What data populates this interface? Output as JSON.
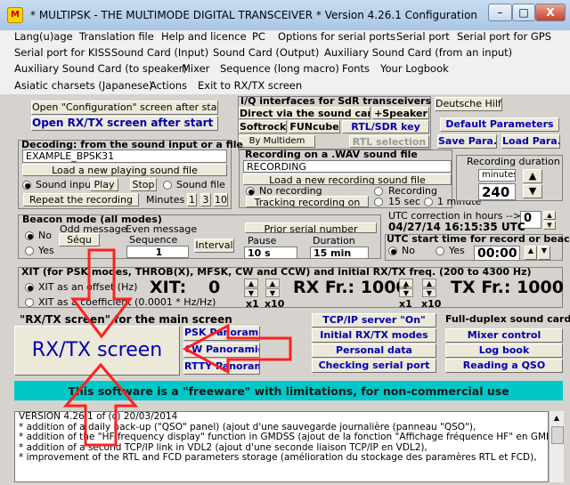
{
  "window": {
    "title": "* MULTIPSK - THE MULTIMODE DIGITAL TRANSCEIVER *   Version 4.26.1     Configuration",
    "icon": "M",
    "min": "–",
    "max": "□",
    "close": "X"
  },
  "menu": {
    "row1": [
      "Lang(u)age",
      "Translation file",
      "Help and licence",
      "PC",
      "Options for serial ports",
      "Serial port",
      "Serial port for GPS"
    ],
    "row2": [
      "Serial port for KISS",
      "Sound Card (Input)",
      "Sound Card (Output)",
      "Auxiliary Sound Card (from an input)"
    ],
    "row3": [
      "Auxiliary Sound Card (to speaker)",
      "Mixer",
      "Sequence (long macro)",
      "Fonts",
      "Your Logbook"
    ],
    "row4": [
      "Asiatic charsets (Japanese)",
      "Actions",
      "Exit to RX/TX screen"
    ]
  },
  "startup": {
    "open_config": "Open \"Configuration\" screen after start up",
    "open_rxtx": "Open RX/TX screen after start up"
  },
  "sdr": {
    "title": "I/Q interfaces for SdR transceivers",
    "direct": "Direct via the sound card",
    "speaker": "+Speaker",
    "softrock": "Softrock",
    "funcube": "FUNcube",
    "rtl_sdr": "RTL/SDR key",
    "multidem": "By Multidem",
    "rtl_sel": "RTL selection"
  },
  "right_buttons": {
    "deutsche": "Deutsche Hilfe",
    "default_params": "Default Parameters",
    "save": "Save Para.",
    "load": "Load Para."
  },
  "decoding": {
    "title": "Decoding: from the sound input or a file",
    "file": "EXAMPLE_BPSK31",
    "load_file": "Load a new playing sound file",
    "sound_input": "Sound input",
    "play": "Play",
    "stop": "Stop",
    "sound_file": "Sound file",
    "repeat": "Repeat the recording",
    "minutes": "Minutes",
    "m1": "1",
    "m3": "3",
    "m10": "10"
  },
  "recording": {
    "title": "Recording on a .WAV sound file",
    "file": "RECORDING",
    "load_file": "Load a new recording sound file",
    "no_rec": "No recording",
    "recording": "Recording",
    "tracking": "Tracking recording on",
    "sec15": "15 sec",
    "min1": "1 minute",
    "duration_label": "Recording duration",
    "minutes_label": "minutes",
    "duration_value": "240"
  },
  "beacon": {
    "title": "Beacon mode (all modes)",
    "no": "No",
    "yes": "Yes",
    "odd": "Odd message",
    "even": "Even message",
    "seq_short": "Séqu",
    "sequence": "Sequence",
    "seq_value": "1",
    "interval": "Interval",
    "prior_serial": "Prior serial number",
    "pause": "Pause",
    "pause_value": "10 s",
    "duration": "Duration",
    "duration_value": "15 min"
  },
  "utc": {
    "correction": "UTC correction in hours -->",
    "correction_value": "0",
    "datetime": "04/27/14 16:15:35 UTC",
    "start_title": "UTC start time for record or beacon",
    "no": "No",
    "yes": "Yes",
    "time": "00:00"
  },
  "xit": {
    "title": "XIT (for PSK modes, THROB(X), MFSK, CW and CCW) and initial RX/TX freq. (200 to 4300 Hz)",
    "as_offset": "XIT as an offset (Hz)",
    "as_coef": "XIT as a coefficient (0.0001 * Hz/Hz)",
    "xit_label": "XIT:",
    "xit_value": "0",
    "rx_label": "RX Fr.: 1000",
    "tx_label": "TX Fr.: 1000",
    "x1": "x1",
    "x10": "x10"
  },
  "rxtx": {
    "caption": "\"RX/TX screen\" for the main screen",
    "button": "RX/TX screen",
    "psk_panoramic": "PSK Panoramic",
    "cw_panoramic": "CW Panoramic",
    "rtty_panoramic": "RTTY Panoramic"
  },
  "tools": {
    "tcpip": "TCP/IP server \"On\"",
    "init_modes": "Initial RX/TX modes",
    "personal": "Personal data",
    "checking": "Checking serial port",
    "fullduplex": "Full-duplex sound card",
    "mixer": "Mixer control",
    "logbook": "Log book",
    "qso": "Reading a QSO"
  },
  "freeware": "This software is a \"freeware\" with limitations, for non-commercial use",
  "log": [
    "VERSION 4.26.1 of (c) 20/03/2014",
    "  * addition of a daily back-up (\"QSO\" panel) (ajout d'une sauvegarde journalière (panneau \"QSO\"),",
    "  * addition of the \"HF frequency display\" function in GMDSS (ajout de la fonction \"Affichage fréquence HF\" en GMDSS),",
    "  * addition of a second TCP/IP link in VDL2 (ajout d'une seconde liaison TCP/IP en VDL2),",
    "  * improvement of the RTL and FCD parameters storage (amélioration du stockage des paramères RTL et FCD),"
  ],
  "colors": {
    "arrow": "#ff2020",
    "cyan": "#00c8c8",
    "blue_text": "#0000b0",
    "face": "#d6d3ce"
  }
}
